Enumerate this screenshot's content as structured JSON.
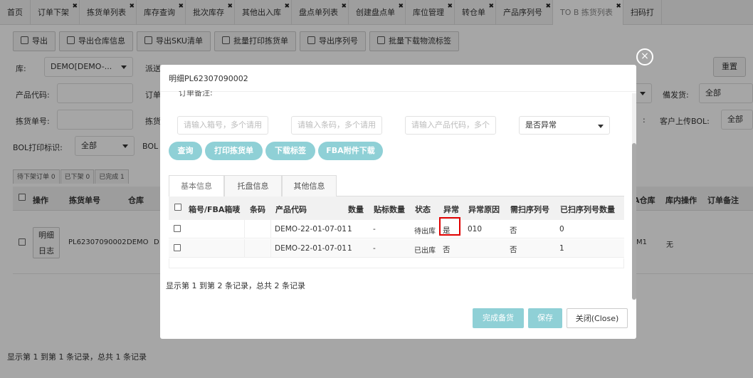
{
  "tabs": [
    {
      "label": "首页",
      "close": false
    },
    {
      "label": "订单下架",
      "close": true
    },
    {
      "label": "拣货单列表",
      "close": true
    },
    {
      "label": "库存查询",
      "close": true
    },
    {
      "label": "批次库存",
      "close": true
    },
    {
      "label": "其他出入库",
      "close": true
    },
    {
      "label": "盘点单列表",
      "close": true
    },
    {
      "label": "创建盘点单",
      "close": true
    },
    {
      "label": "库位管理",
      "close": true
    },
    {
      "label": "转仓单",
      "close": true
    },
    {
      "label": "产品序列号",
      "close": true
    },
    {
      "label": "TO B 拣货列表",
      "close": true,
      "active": true
    },
    {
      "label": "扫码打",
      "close": false
    }
  ],
  "toolbar": {
    "export": "导出",
    "export_wh": "导出仓库信息",
    "export_sku": "导出SKU清单",
    "batch_print": "批量打印拣货单",
    "export_serial": "导出序列号",
    "batch_download": "批量下载物流标签"
  },
  "filters": {
    "warehouse_label": "库:",
    "warehouse_value": "DEMO[DEMO-...",
    "dispatch_label": "派送",
    "product_code_label": "产品代码:",
    "order_label": "订单",
    "pick_no_label": "拣货单号:",
    "pick_label2": "拣货",
    "bol_label": "BOL打印标识:",
    "bol_value": "全部",
    "bol2_label": "BOL",
    "reset": "重置",
    "prep_label": "備发货:",
    "prep_value": "全部",
    "upload_bol_label": "客户上传BOL:",
    "upload_bol_value": "全部",
    "colon": ":"
  },
  "status_tabs": [
    "待下架订单 0",
    "已下架 0",
    "已完成 1"
  ],
  "grid": {
    "headers": {
      "op": "操作",
      "pick_no": "拣货单号",
      "warehouse": "仓库",
      "target_wh": "A仓库",
      "in_op": "库内操作",
      "remark": "订单备注"
    },
    "row": {
      "detail": "明细",
      "log": "日志",
      "pick_no": "PL62307090002",
      "warehouse": "DEMO",
      "d": "D",
      "target_wh": "M1",
      "in_op": "无"
    },
    "footer": "显示第 1 到第 1 条记录，总共 1 条记录"
  },
  "modal": {
    "title": "明细PL62307090002",
    "partial_label": "订单备注:",
    "box_ph": "请输入箱号，多个请用",
    "barcode_ph": "请输入条码，多个请用",
    "product_ph": "请输入产品代码，多个",
    "abnormal_select": "是否异常",
    "btn_query": "查询",
    "btn_print": "打印拣货单",
    "btn_label": "下载标签",
    "btn_fba": "FBA附件下载",
    "tabs": [
      "基本信息",
      "托盘信息",
      "其他信息"
    ],
    "headers": {
      "box": "箱号/FBA箱唛",
      "barcode": "条码",
      "product": "产品代码",
      "qty": "数量",
      "label_qty": "贴标数量",
      "status": "状态",
      "abnormal": "异常",
      "reason": "异常原因",
      "need_scan": "需扫序列号",
      "scanned": "已扫序列号数量"
    },
    "rows": [
      {
        "box": "",
        "barcode": "",
        "product": "DEMO-22-01-07-01",
        "qty": "1",
        "label_qty": "-",
        "status": "待出库",
        "abnormal": "是",
        "reason": "010",
        "need_scan": "否",
        "scanned": "0"
      },
      {
        "box": "",
        "barcode": "",
        "product": "DEMO-22-01-07-01",
        "qty": "1",
        "label_qty": "-",
        "status": "已出库",
        "abnormal": "否",
        "reason": "",
        "need_scan": "否",
        "scanned": "1"
      }
    ],
    "footer": "显示第 1 到第 2 条记录，总共 2 条记录",
    "btn_finish": "完成备货",
    "btn_save": "保存",
    "btn_close": "关闭(Close)",
    "close_glyph": "×",
    "highlight_color": "#e00000"
  }
}
